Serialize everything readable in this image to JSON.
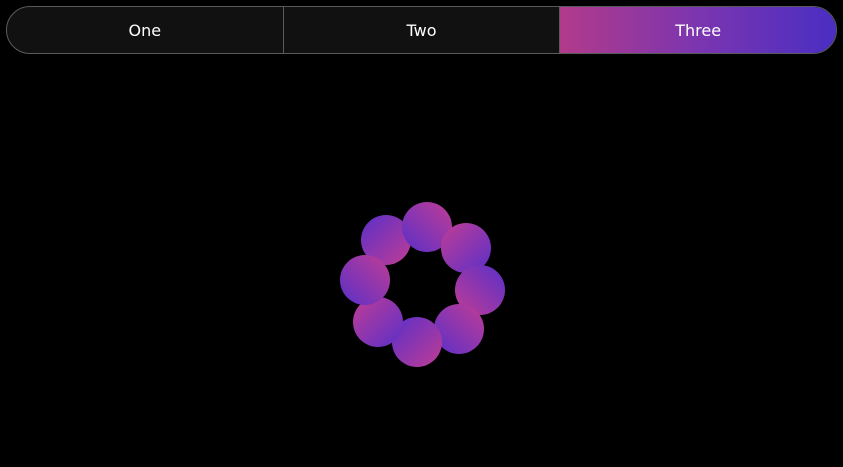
{
  "tabs": [
    {
      "label": "One",
      "active": false
    },
    {
      "label": "Two",
      "active": false
    },
    {
      "label": "Three",
      "active": true
    }
  ],
  "colors": {
    "background": "#000000",
    "tab_bg": "#111111",
    "tab_border": "#5a5a5a",
    "accent_start": "#b23a8a",
    "accent_end": "#4a2ec2",
    "dot_pink": "#c03c95",
    "dot_blue": "#5a30c8"
  },
  "loader": {
    "type": "spinner",
    "dot_count": 8
  }
}
